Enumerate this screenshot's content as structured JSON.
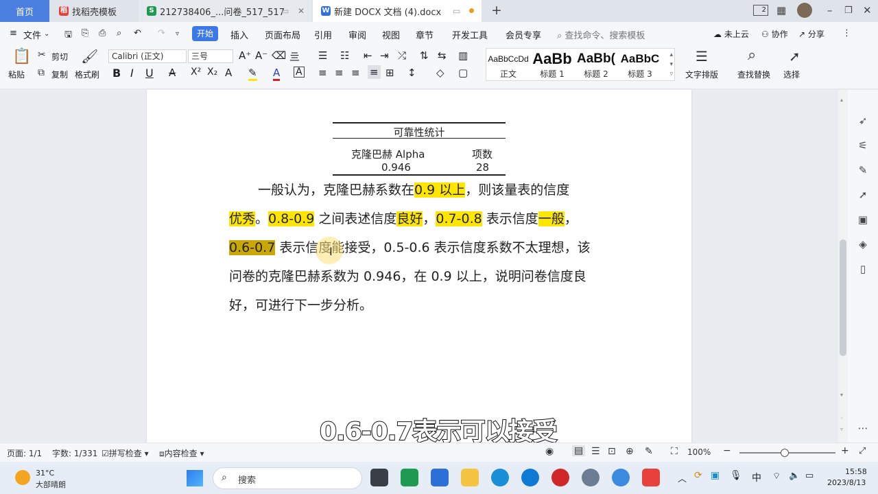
{
  "tabs": [
    {
      "label": "首页"
    },
    {
      "label": "找稻壳模板"
    },
    {
      "label": "212738406_...问卷_517_517"
    },
    {
      "label": "新建 DOCX 文档 (4).docx"
    }
  ],
  "tabbar": {
    "new_tab": "+",
    "badge": "2"
  },
  "menu": {
    "file": "文件",
    "items": [
      "开始",
      "插入",
      "页面布局",
      "引用",
      "审阅",
      "视图",
      "章节",
      "开发工具",
      "会员专享"
    ],
    "search_placeholder": "查找命令、搜索模板",
    "cloud": "未上云",
    "collab": "协作",
    "share": "分享"
  },
  "ribbon": {
    "paste": "粘贴",
    "cut": "剪切",
    "copy": "复制",
    "format_painter": "格式刷",
    "font_name": "Calibri (正文)",
    "font_size": "三号",
    "styles": [
      {
        "preview": "AaBbCcDd",
        "label": "正文"
      },
      {
        "preview": "AaBb",
        "label": "标题 1"
      },
      {
        "preview": "AaBb(",
        "label": "标题 2"
      },
      {
        "preview": "AaBbC",
        "label": "标题 3"
      }
    ],
    "text_layout": "文字排版",
    "find_replace": "查找替换",
    "select": "选择"
  },
  "document": {
    "table": {
      "title": "可靠性统计",
      "col1_header": "克隆巴赫 Alpha",
      "col2_header": "项数",
      "col1_value": "0.946",
      "col2_value": "28"
    },
    "para": {
      "l1a": "一般认为，克隆巴赫系数在",
      "l1b": "0.9 以上",
      "l1c": "，则该量表的信度",
      "l2a": "优秀",
      "l2b": "。",
      "l2c": "0.8-0.9",
      "l2d": " 之间表述信度",
      "l2e": "良好",
      "l2f": "，",
      "l2g": "0.7-0.8",
      "l2h": " 表示信度",
      "l2i": "一般",
      "l2j": "，",
      "l3a": "0.6-0.7",
      "l3b": " 表示信度能接受，0.5-0.6 表示信度系数不太理想，该",
      "l4": "问卷的克隆巴赫系数为 0.946，在 0.9 以上，说明问卷信度良",
      "l5": "好，可进行下一步分析。"
    },
    "caption": "0.6-0.7表示可以接受"
  },
  "status": {
    "page": "页面: 1/1",
    "words": "字数: 1/331",
    "spell": "拼写检查",
    "content": "内容检查",
    "zoom": "100%"
  },
  "taskbar": {
    "weather_temp": "31°C",
    "weather_desc": "大部晴朗",
    "search": "搜索",
    "ime": "中",
    "time": "15:58",
    "date": "2023/8/13"
  },
  "colors": {
    "accent": "#3d79e6",
    "highlight": "#ffe600",
    "highlight_selected": "#c9a704"
  }
}
